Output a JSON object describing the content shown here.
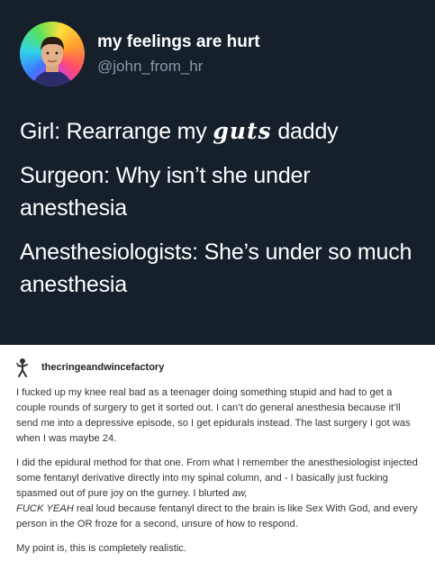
{
  "tweet": {
    "display_name": "my feelings are hurt",
    "handle": "@john_from_hr",
    "line1_before": "Girl: Rearrange my ",
    "line1_styled": "guts",
    "line1_after": " daddy",
    "line2": "Surgeon: Why isn’t she under anesthesia",
    "line3": "Anesthesiologists: She’s under so much anesthesia"
  },
  "post": {
    "username": "thecringeandwincefactory",
    "paragraph1": "I fucked up my knee real bad as a teenager doing something stupid and had to get a couple rounds of surgery to get it sorted out. I can’t do general anesthesia because it’ll send me into a depressive episode, so I get epidurals instead. The last surgery I got was when I was maybe 24.",
    "paragraph2_start": "I did the epidural method for that one. From what I remember the anesthesiologist injected some fentanyl derivative directly into my spinal column, and - I basically just fucking spasmed out of pure joy on the gurney. I blurted ",
    "paragraph2_em1": "aw,",
    "paragraph2_em2": "FUCK YEAH",
    "paragraph2_end": " real loud because fentanyl direct to the brain is like Sex With God, and every person in the OR froze for a second, unsure of how to respond.",
    "paragraph3": "My point is, this is completely realistic."
  },
  "colors": {
    "tweet_background": "#15202b",
    "handle_gray": "#8899a6"
  },
  "icons": {
    "tweet_avatar": "profile-photo-avatar",
    "post_avatar": "figure-avatar"
  }
}
